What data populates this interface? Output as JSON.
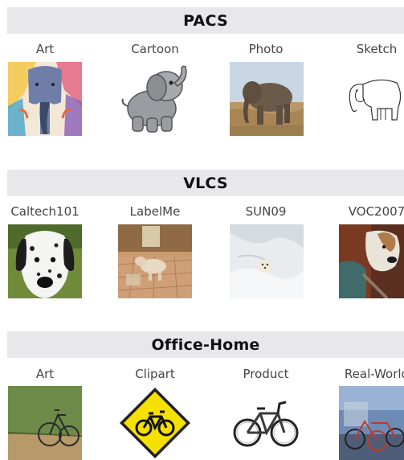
{
  "sections": [
    {
      "title": "PACS",
      "domains": [
        {
          "label": "Art",
          "icon": "elephant-art-painting"
        },
        {
          "label": "Cartoon",
          "icon": "elephant-cartoon"
        },
        {
          "label": "Photo",
          "icon": "elephant-photo"
        },
        {
          "label": "Sketch",
          "icon": "elephant-sketch"
        }
      ]
    },
    {
      "title": "VLCS",
      "domains": [
        {
          "label": "Caltech101",
          "icon": "dalmatian-photo"
        },
        {
          "label": "LabelMe",
          "icon": "dog-indoor-photo"
        },
        {
          "label": "SUN09",
          "icon": "dog-in-snow-photo"
        },
        {
          "label": "VOC2007",
          "icon": "dog-close-up-photo"
        }
      ]
    },
    {
      "title": "Office-Home",
      "domains": [
        {
          "label": "Art",
          "icon": "bicycle-painting"
        },
        {
          "label": "Clipart",
          "icon": "bicycle-sign-clipart"
        },
        {
          "label": "Product",
          "icon": "bicycle-product-photo"
        },
        {
          "label": "Real-World",
          "icon": "bicycles-street-photo"
        }
      ]
    }
  ]
}
